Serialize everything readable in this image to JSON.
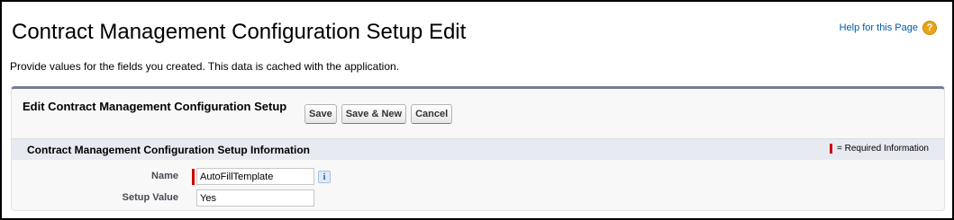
{
  "header": {
    "title": "Contract Management Configuration Setup Edit",
    "help_label": "Help for this Page",
    "help_icon": "help-question-icon",
    "description": "Provide values for the fields you created. This data is cached with the application."
  },
  "edit_block": {
    "title": "Edit Contract Management Configuration Setup",
    "buttons": {
      "save": "Save",
      "save_new": "Save & New",
      "cancel": "Cancel"
    }
  },
  "section": {
    "title": "Contract Management Configuration Setup Information",
    "required_legend": "= Required Information"
  },
  "fields": [
    {
      "label": "Name",
      "value": "AutoFillTemplate",
      "required": true,
      "info_icon": "info-icon"
    },
    {
      "label": "Setup Value",
      "value": "Yes",
      "required": false
    }
  ],
  "colors": {
    "required": "#cc0000",
    "link": "#015ba7",
    "block_border": "#737e96",
    "section_bg": "#e8eaf2"
  }
}
